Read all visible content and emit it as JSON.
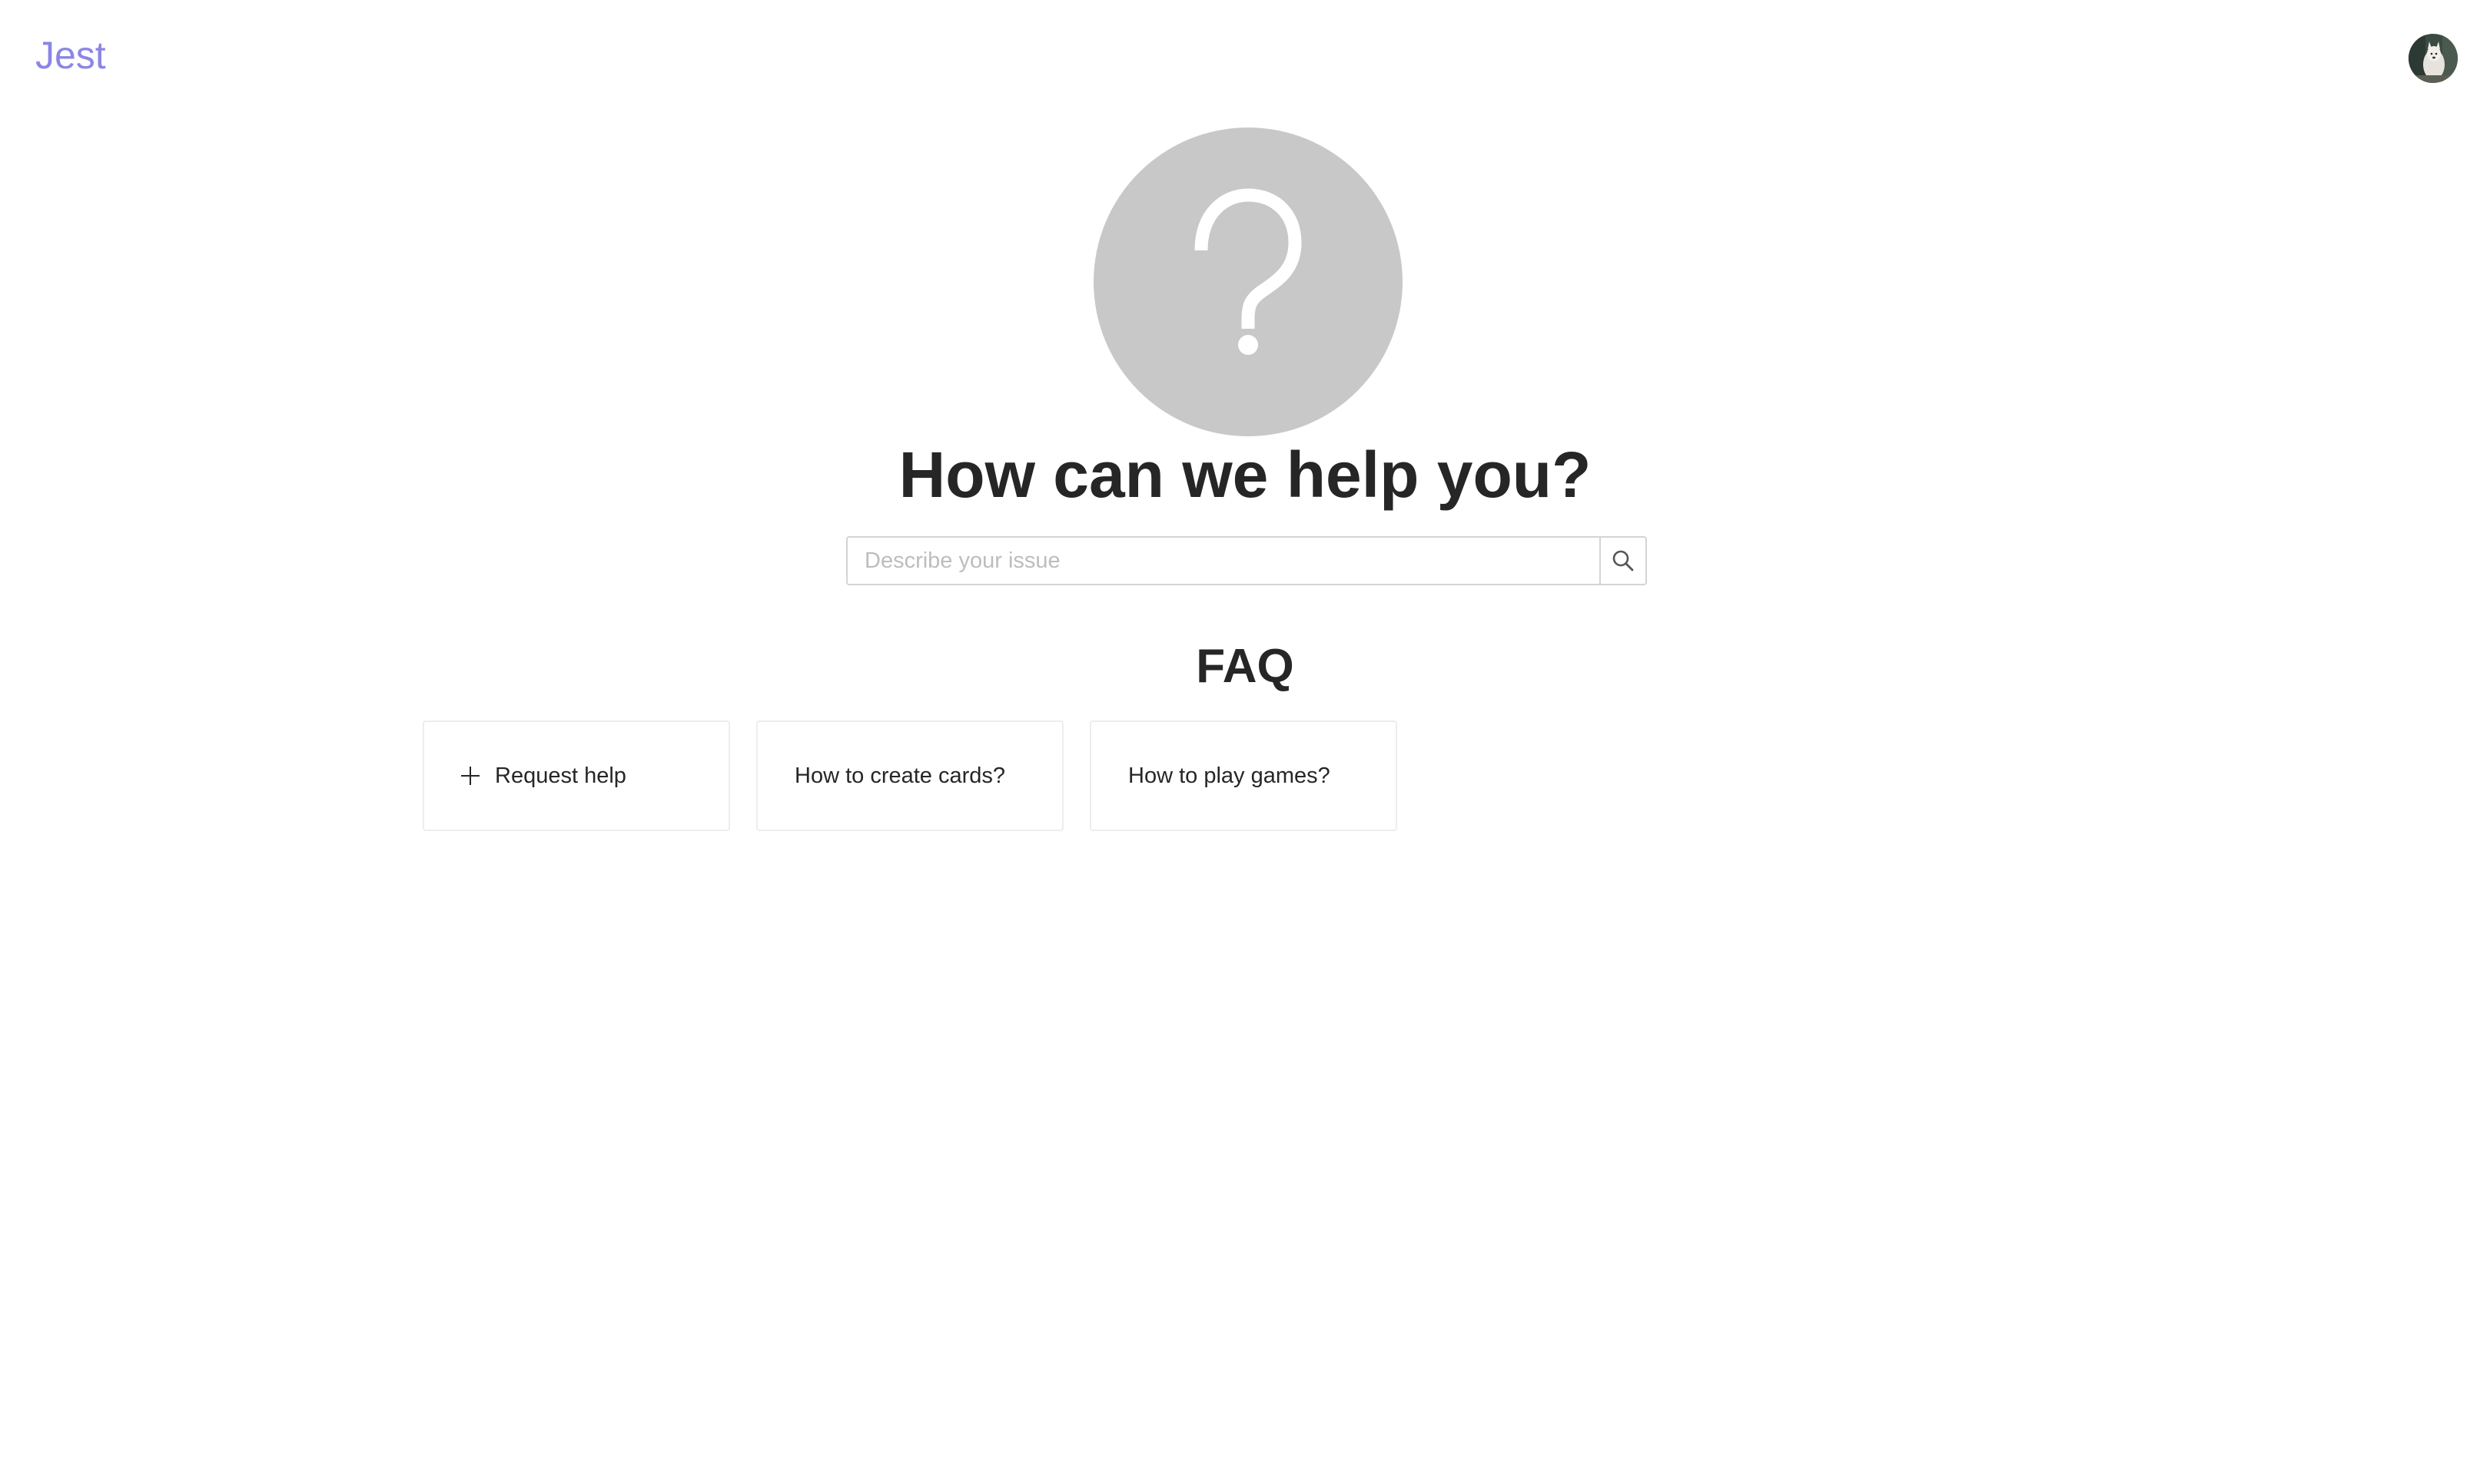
{
  "header": {
    "logo_text": "Jest",
    "avatar_icon": "user-avatar"
  },
  "hero": {
    "icon": "question-mark-icon",
    "title": "How can we help you?"
  },
  "search": {
    "placeholder": "Describe your issue",
    "value": "",
    "button_icon": "search-icon"
  },
  "faq": {
    "title": "FAQ",
    "cards": [
      {
        "label": "Request help",
        "icon": "plus-icon"
      },
      {
        "label": "How to create cards?"
      },
      {
        "label": "How to play games?"
      }
    ]
  },
  "colors": {
    "brand": "#8b86e6",
    "hero_circle": "#c8c8c8",
    "text": "#262626",
    "border": "#d4d4d4"
  }
}
